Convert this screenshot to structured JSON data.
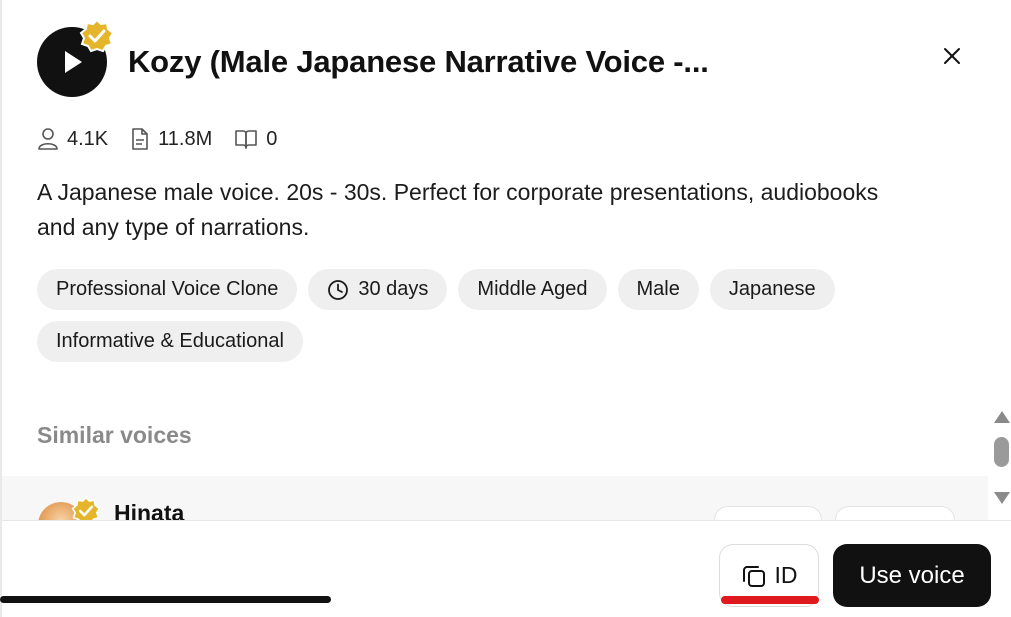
{
  "voice": {
    "title": "Kozy (Male Japanese Narrative Voice -...",
    "description": "A Japanese male voice. 20s - 30s. Perfect for corporate presentations, audiobooks and any type of narrations.",
    "stats": {
      "users": "4.1K",
      "characters": "11.8M",
      "books": "0"
    },
    "tags": {
      "t0": "Professional Voice Clone",
      "t1": "30 days",
      "t2": "Middle Aged",
      "t3": "Male",
      "t4": "Japanese",
      "t5": "Informative & Educational"
    }
  },
  "similar": {
    "heading": "Similar voices",
    "items": [
      {
        "name": "Hinata"
      }
    ]
  },
  "footer": {
    "id_label": "ID",
    "use_label": "Use voice"
  },
  "colors": {
    "accent_badge": "#e5b62b",
    "primary_button": "#111111",
    "tag_background": "#efefef",
    "highlight_underline": "#e0191f"
  },
  "icons": {
    "play": "play-icon",
    "verified": "verified-badge-icon",
    "close": "close-icon",
    "users": "user-icon",
    "characters": "document-icon",
    "books": "book-icon",
    "clock": "clock-icon",
    "copy": "copy-icon"
  }
}
